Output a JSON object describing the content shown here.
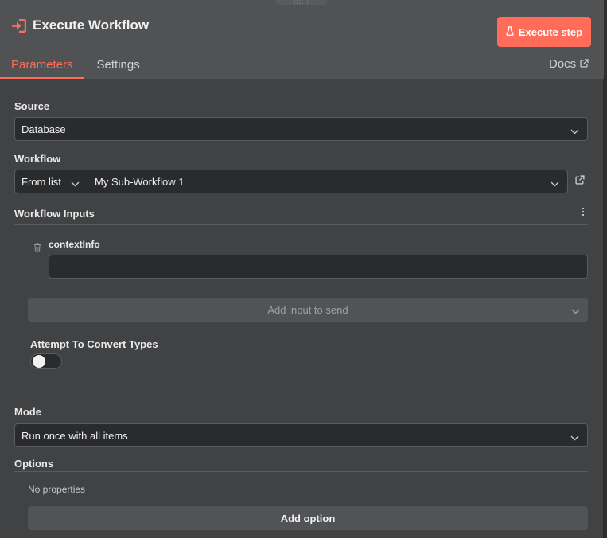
{
  "header": {
    "title": "Execute Workflow",
    "title_icon": "sign-in-arrow-icon",
    "execute_button": {
      "label": "Execute step",
      "icon": "flask-icon"
    },
    "drag_handle_glyph": "::::::",
    "tabs": [
      {
        "label": "Parameters",
        "active": true
      },
      {
        "label": "Settings",
        "active": false
      }
    ],
    "docs": {
      "label": "Docs",
      "icon": "external-link-icon"
    }
  },
  "params": {
    "source": {
      "label": "Source",
      "value": "Database"
    },
    "workflow": {
      "label": "Workflow",
      "mode_value": "From list",
      "workflow_value": "My Sub-Workflow 1"
    },
    "workflow_inputs": {
      "label": "Workflow Inputs",
      "items": [
        {
          "name": "contextInfo",
          "value": ""
        }
      ],
      "add_input_label": "Add input to send"
    },
    "convert_types": {
      "label": "Attempt To Convert Types",
      "enabled": false
    },
    "mode": {
      "label": "Mode",
      "value": "Run once with all items"
    },
    "options": {
      "label": "Options",
      "empty_text": "No properties",
      "add_option_label": "Add option"
    }
  },
  "colors": {
    "accent": "#ff6d5a",
    "panel_bg": "#414244",
    "header_bg": "#515254",
    "input_bg": "#2a2b2d"
  }
}
